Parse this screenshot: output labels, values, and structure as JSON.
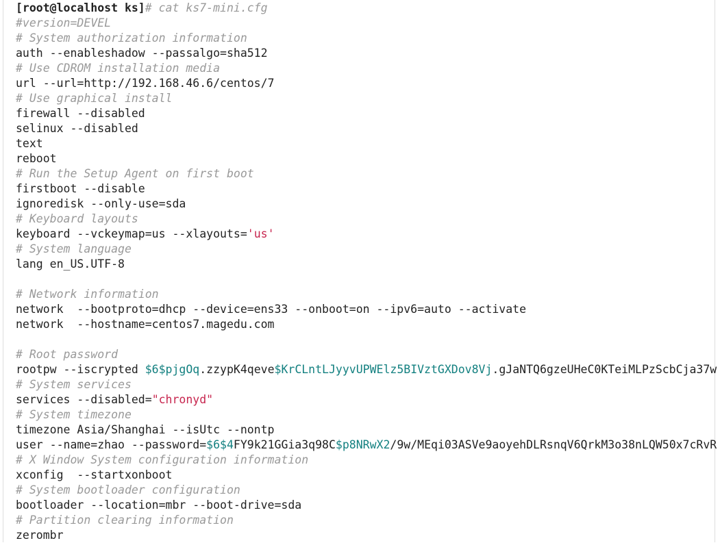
{
  "colors": {
    "text": "#222222",
    "comment": "#999999",
    "string": "#c7254e",
    "variable": "#138080"
  },
  "terminal": {
    "lines": [
      [
        {
          "t": "[root@localhost ks]",
          "c": "prompt"
        },
        {
          "t": "# cat ks7-mini.cfg",
          "c": "comment"
        }
      ],
      [
        {
          "t": "#version=DEVEL",
          "c": "comment"
        }
      ],
      [
        {
          "t": "# System authorization information",
          "c": "comment"
        }
      ],
      [
        {
          "t": "auth --enableshadow --passalgo=sha512",
          "c": "plain"
        }
      ],
      [
        {
          "t": "# Use CDROM installation media",
          "c": "comment"
        }
      ],
      [
        {
          "t": "url --url=http://192.168.46.6/centos/7",
          "c": "plain"
        }
      ],
      [
        {
          "t": "# Use graphical install",
          "c": "comment"
        }
      ],
      [
        {
          "t": "firewall --disabled",
          "c": "plain"
        }
      ],
      [
        {
          "t": "selinux --disabled",
          "c": "plain"
        }
      ],
      [
        {
          "t": "text",
          "c": "plain"
        }
      ],
      [
        {
          "t": "reboot",
          "c": "plain"
        }
      ],
      [
        {
          "t": "# Run the Setup Agent on first boot",
          "c": "comment"
        }
      ],
      [
        {
          "t": "firstboot --disable",
          "c": "plain"
        }
      ],
      [
        {
          "t": "ignoredisk --only-use=sda",
          "c": "plain"
        }
      ],
      [
        {
          "t": "# Keyboard layouts",
          "c": "comment"
        }
      ],
      [
        {
          "t": "keyboard --vckeymap=us --xlayouts=",
          "c": "plain"
        },
        {
          "t": "'us'",
          "c": "str"
        }
      ],
      [
        {
          "t": "# System language",
          "c": "comment"
        }
      ],
      [
        {
          "t": "lang en_US.UTF-8",
          "c": "plain"
        }
      ],
      [],
      [
        {
          "t": "# Network information",
          "c": "comment"
        }
      ],
      [
        {
          "t": "network  --bootproto=dhcp --device=ens33 --onboot=on --ipv6=auto --activate",
          "c": "plain"
        }
      ],
      [
        {
          "t": "network  --hostname=centos7.magedu.com",
          "c": "plain"
        }
      ],
      [],
      [
        {
          "t": "# Root password",
          "c": "comment"
        }
      ],
      [
        {
          "t": "rootpw --iscrypted ",
          "c": "plain"
        },
        {
          "t": "$6$pjgOq",
          "c": "var"
        },
        {
          "t": ".zzypK4qeve",
          "c": "plain"
        },
        {
          "t": "$KrCLntLJyyvUPWElz5BIVztGXDov8Vj",
          "c": "var"
        },
        {
          "t": ".gJaNTQ6gzeUHeC0KTeiMLPzScbCja37w",
          "c": "plain"
        }
      ],
      [
        {
          "t": "# System services",
          "c": "comment"
        }
      ],
      [
        {
          "t": "services --disabled=",
          "c": "plain"
        },
        {
          "t": "\"chronyd\"",
          "c": "str"
        }
      ],
      [
        {
          "t": "# System timezone",
          "c": "comment"
        }
      ],
      [
        {
          "t": "timezone Asia/Shanghai --isUtc --nontp",
          "c": "plain"
        }
      ],
      [
        {
          "t": "user --name=zhao --password=",
          "c": "plain"
        },
        {
          "t": "$6$4",
          "c": "var"
        },
        {
          "t": "FY9k21GGia3q98C",
          "c": "plain"
        },
        {
          "t": "$p8NRwX2",
          "c": "var"
        },
        {
          "t": "/9w/MEqi03ASVe9aoyehDLRsnqV6QrkM3o38nLQW50x7cRvR",
          "c": "plain"
        }
      ],
      [
        {
          "t": "# X Window System configuration information",
          "c": "comment"
        }
      ],
      [
        {
          "t": "xconfig  --startxonboot",
          "c": "plain"
        }
      ],
      [
        {
          "t": "# System bootloader configuration",
          "c": "comment"
        }
      ],
      [
        {
          "t": "bootloader --location=mbr --boot-drive=sda",
          "c": "plain"
        }
      ],
      [
        {
          "t": "# Partition clearing information",
          "c": "comment"
        }
      ],
      [
        {
          "t": "zerombr",
          "c": "plain"
        }
      ]
    ]
  }
}
